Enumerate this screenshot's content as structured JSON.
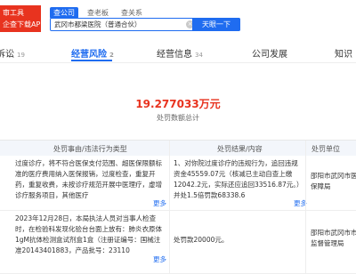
{
  "logo": {
    "line1": "审工具",
    "line2": "企查下载APP"
  },
  "top_tabs": [
    "查公司",
    "查老板",
    "查关系"
  ],
  "search": {
    "value": "武冈市都梁医院（普通合伙）",
    "button": "天眼一下"
  },
  "nav": [
    {
      "label": "诉讼",
      "count": "19"
    },
    {
      "label": "经营风险",
      "count": "2"
    },
    {
      "label": "经营信息",
      "count": "34"
    },
    {
      "label": "公司发展",
      "count": ""
    },
    {
      "label": "知识",
      "count": ""
    }
  ],
  "penalty": {
    "amount": "19.277033万元",
    "label": "处罚数额总计"
  },
  "table": {
    "headers": [
      "处罚事由/违法行为类型",
      "处罚结果/内容",
      "处罚单位"
    ],
    "rows": [
      {
        "reason": "过度诊疗，将不符合医保支付范围、超医保限额标准的医疗费用纳入医保报销，过度检查，重复开药，重复收费，未按诊疗规范开展中医理疗，虚增诊疗服务项目，其他医疗",
        "reason_more": "更多",
        "result": "1、对你院过度诊疗的违规行为，追回违规资金45559.07元（核减已主动自查上缴12042.2元，实际还应追回33516.87元。）并处1.5倍罚款68338.6",
        "result_more": "更多",
        "unit": "邵阳市武冈市医疗保障局"
      },
      {
        "reason": "2023年12月28日，本局执法人员对当事人检查时，在检验科发现化验台台面上放有：肺炎衣原体1gM抗体检测盒试剂盒1盒（注册证编号：国械注准20143401883，产品批号：23110",
        "reason_more": "更多",
        "result": "处罚款20000元。",
        "result_more": "",
        "unit": "邵阳市武冈市市场监督管理局"
      }
    ]
  }
}
